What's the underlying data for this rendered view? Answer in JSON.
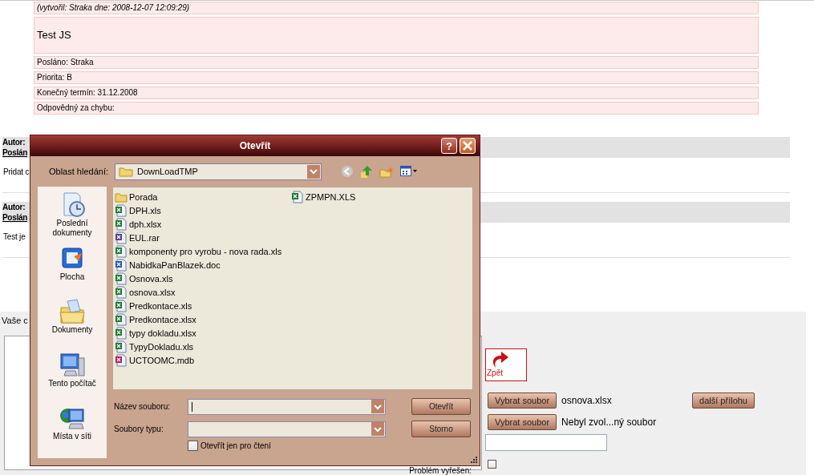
{
  "record": {
    "created": "(vytvořil: Straka dne: 2008-12-07 12:09:29)",
    "subject": "Test JS",
    "fields": [
      "Posláno: Straka",
      "Priorita: B",
      "Konečný termín: 31.12.2008",
      "Odpovědný za chybu:"
    ]
  },
  "comments": [
    {
      "author_label": "Autor:",
      "sent_label": "Poslán",
      "text": "Pridat c"
    },
    {
      "author_label": "Autor:",
      "sent_label": "Poslán",
      "text": "Test je"
    }
  ],
  "reply": {
    "label": "Vaše c",
    "back": "Zpět",
    "attachments": [
      {
        "button": "Vybrat soubor",
        "file": "osnova.xlsx"
      },
      {
        "button": "Vybrat soubor",
        "file": "Nebyl zvol...ný soubor"
      }
    ],
    "more_button": "další přílohu",
    "solved_label": "Problém vyřešen:",
    "solved": false
  },
  "dialog": {
    "title": "Otevřít",
    "help_button": "?",
    "look_in_label": "Oblast hledání:",
    "look_in": "DownLoadTMP",
    "places": [
      {
        "label": "Poslední dokumenty",
        "kind": "recent"
      },
      {
        "label": "Plocha",
        "kind": "desktop"
      },
      {
        "label": "Dokumenty",
        "kind": "documents"
      },
      {
        "label": "Tento počítač",
        "kind": "computer"
      },
      {
        "label": "Místa v síti",
        "kind": "network"
      }
    ],
    "files": [
      {
        "name": "Porada",
        "kind": "folder"
      },
      {
        "name": "DPH.xls",
        "kind": "excel"
      },
      {
        "name": "dph.xlsx",
        "kind": "excel"
      },
      {
        "name": "EUL.rar",
        "kind": "rar"
      },
      {
        "name": "komponenty pro vyrobu - nova rada.xls",
        "kind": "excel"
      },
      {
        "name": "NabidkaPanBlazek.doc",
        "kind": "word"
      },
      {
        "name": "Osnova.xls",
        "kind": "excel"
      },
      {
        "name": "osnova.xlsx",
        "kind": "excel"
      },
      {
        "name": "Predkontace.xls",
        "kind": "excel"
      },
      {
        "name": "Predkontace.xlsx",
        "kind": "excel"
      },
      {
        "name": "typy dokladu.xlsx",
        "kind": "excel"
      },
      {
        "name": "TypyDokladu.xls",
        "kind": "excel"
      },
      {
        "name": "UCTOOMC.mdb",
        "kind": "access"
      },
      {
        "name": "ZPMPN.XLS",
        "kind": "excel"
      }
    ],
    "file_name_label": "Název souboru:",
    "file_type_label": "Soubory typu:",
    "read_only_label": "Otevřít jen pro čtení",
    "read_only": false,
    "open_button": "Otevřít",
    "cancel_button": "Storno"
  }
}
